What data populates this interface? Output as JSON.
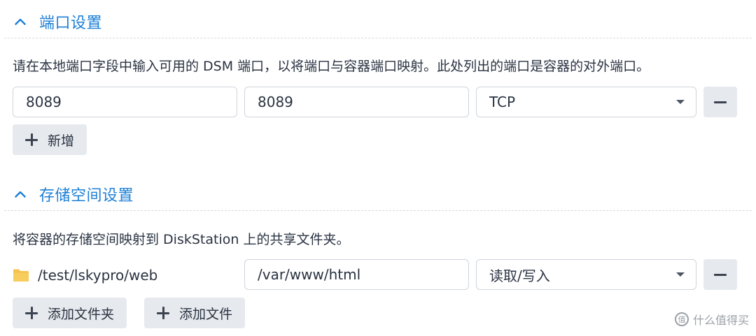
{
  "port_section": {
    "title": "端口设置",
    "description": "请在本地端口字段中输入可用的 DSM 端口，以将端口与容器端口映射。此处列出的端口是容器的对外端口。",
    "local_port": "8089",
    "container_port": "8089",
    "protocol": "TCP",
    "add_label": "新增"
  },
  "storage_section": {
    "title": "存储空间设置",
    "description": "将容器的存储空间映射到 DiskStation 上的共享文件夹。",
    "folder_path": "/test/lskypro/web",
    "mount_path": "/var/www/html",
    "permission": "读取/写入",
    "add_folder_label": "添加文件夹",
    "add_file_label": "添加文件"
  },
  "watermark": {
    "icon_text": "值",
    "text": "什么值得买"
  },
  "icons": {
    "collapse": "chevron-up-icon",
    "remove": "minus-icon",
    "add": "plus-icon",
    "dropdown": "caret-down-icon",
    "folder": "folder-icon"
  },
  "colors": {
    "accent": "#1d7fd6",
    "folder": "#f5c24c",
    "button_bg": "#e6e9ed"
  }
}
